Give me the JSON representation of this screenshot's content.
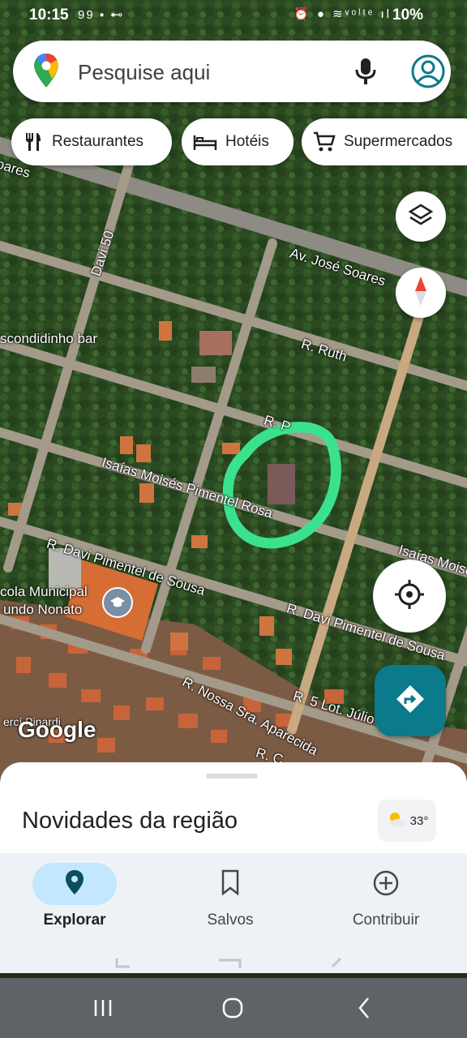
{
  "status_bar": {
    "time": "10:15",
    "notification_icons": "99 ▪ ⊷",
    "system_icons": "⏰ ● ≋ᵛᵒˡᵗᵉ ıl",
    "battery": "10%"
  },
  "search": {
    "placeholder": "Pesquise aqui"
  },
  "chips": [
    {
      "label": "Restaurantes",
      "icon": "fork-knife-icon"
    },
    {
      "label": "Hotéis",
      "icon": "bed-icon"
    },
    {
      "label": "Supermercados",
      "icon": "cart-icon"
    }
  ],
  "map": {
    "labels": [
      "oares",
      "Davi 50",
      "Av. José Soares",
      "scondidinho bar",
      "R. Ruth",
      "R. P",
      "Isaías Moisés Pimentel Rosa",
      "R. Davi Pimentel de Sousa",
      "Isaías Moisé",
      "cola Municipal",
      "undo Nonato",
      "R. Davi Pimentel de Sousa",
      "R. Nossa Sra. Aparecida",
      "R. 5 Lot. Júlio Sa",
      "R. C",
      "ercí Pinardi"
    ],
    "watermark": "Google",
    "highlight_color": "#3be28e"
  },
  "sheet": {
    "title": "Novidades da região",
    "weather_temp": "33°"
  },
  "bottom_nav": [
    {
      "label": "Explorar",
      "icon": "location-pin-icon",
      "active": true
    },
    {
      "label": "Salvos",
      "icon": "bookmark-icon",
      "active": false
    },
    {
      "label": "Contribuir",
      "icon": "add-circle-icon",
      "active": false
    }
  ],
  "colors": {
    "accent": "#0b7a8a",
    "active_pill": "#c2e7ff"
  }
}
